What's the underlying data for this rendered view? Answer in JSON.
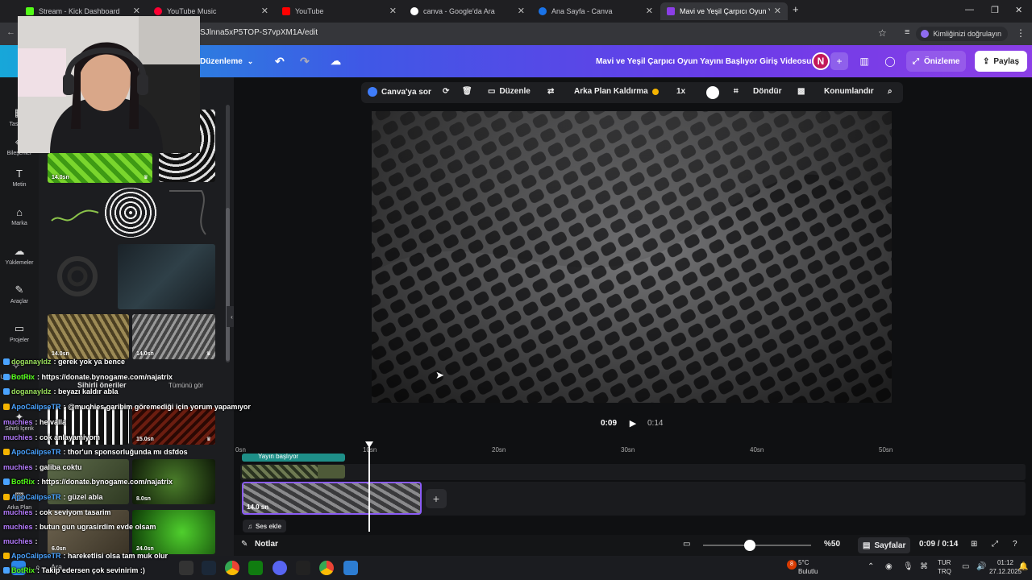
{
  "browser": {
    "tabs": [
      {
        "label": "Stream - Kick Dashboard",
        "color": "#53fc18"
      },
      {
        "label": "YouTube Music",
        "color": "#ff0033"
      },
      {
        "label": "YouTube",
        "color": "#ff0000"
      },
      {
        "label": "canva - Google'da Ara",
        "color": "#ffffff"
      },
      {
        "label": "Ana Sayfa - Canva",
        "color": "#1a73e8"
      },
      {
        "label": "Mavi ve Yeşil Çarpıcı Oyun Yayını",
        "color": "#8b3ee6"
      }
    ],
    "new_tab": "+",
    "url": "SJlnna5xP5TOP-S7vpXM1A/edit",
    "verify_label": "Kimliğinizi doğrulayın"
  },
  "canva_header": {
    "edit_menu": "Düzenleme",
    "doc_title": "Mavi ve Yeşil Çarpıcı Oyun Yayını Başlıyor Giriş Videosu",
    "avatar_letter": "N",
    "preview": "Önizleme",
    "share": "Paylaş"
  },
  "left_rail": [
    {
      "label": "Tasarım",
      "icon": "layout-icon"
    },
    {
      "label": "Bileşenler",
      "icon": "elements-icon"
    },
    {
      "label": "Metin",
      "icon": "text-icon"
    },
    {
      "label": "Marka",
      "icon": "brand-icon"
    },
    {
      "label": "Yüklemeler",
      "icon": "upload-icon"
    },
    {
      "label": "Araçlar",
      "icon": "tools-icon"
    },
    {
      "label": "Projeler",
      "icon": "folder-icon"
    },
    {
      "label": "Uygulamalar",
      "icon": "apps-icon"
    },
    {
      "label": "Sihirli İçerik",
      "icon": "magic-icon"
    },
    {
      "label": "Arka Plan",
      "icon": "background-icon"
    }
  ],
  "side_panel": {
    "thumbs": [
      {
        "dur": "14.0sn"
      },
      {
        "dur": "14.0sn"
      },
      {
        "dur": "14.0sn"
      },
      {
        "dur": "15.0sn"
      },
      {
        "dur": "8.0sn"
      },
      {
        "dur": "6.0sn"
      },
      {
        "dur": "24.0sn"
      }
    ],
    "section_title": "Sihirli öneriler",
    "section_link": "Tümünü gör"
  },
  "context_toolbar": {
    "ask_canva": "Canva'ya sor",
    "edit": "Düzenle",
    "bg_remove": "Arka Plan Kaldırma",
    "speed": "1x",
    "rotate": "Döndür",
    "position": "Konumlandır"
  },
  "playback": {
    "current": "0:09",
    "total": "0:14"
  },
  "timeline": {
    "ticks": [
      "0sn",
      "10sn",
      "20sn",
      "30sn",
      "40sn",
      "50sn"
    ],
    "text_track_label": "Yayın başlıyor",
    "clip_duration": "14.0 sn",
    "add_audio": "Ses ekle",
    "progress_fraction": 0.64
  },
  "bottom_bar": {
    "notes": "Notlar",
    "zoom": "%50",
    "zoom_fraction": 0.43,
    "pages": "Sayfalar",
    "time": "0:09 / 0:14"
  },
  "chat": [
    {
      "user": "doganayldz",
      "msg": ": gerek yok ya bence",
      "color": "#9be15d"
    },
    {
      "user": "BotRix",
      "msg": ": https://donate.bynogame.com/najatrix",
      "color": "#53fc18"
    },
    {
      "user": "doganayldz",
      "msg": ": beyazı kaldır abla",
      "color": "#9be15d"
    },
    {
      "user": "ApoCalipseTR",
      "msg": ": @muchies garibim göremediği için yorum yapamıyor",
      "color": "#4aa3ff"
    },
    {
      "user": "muchies",
      "msg": ": he valla",
      "color": "#b57bff"
    },
    {
      "user": "muchies",
      "msg": ": cok anlayamiyom",
      "color": "#b57bff"
    },
    {
      "user": "ApoCalipseTR",
      "msg": ": thor'un sponsorluğunda mı dsfdos",
      "color": "#4aa3ff"
    },
    {
      "user": "muchies",
      "msg": ": galiba coktu",
      "color": "#b57bff"
    },
    {
      "user": "BotRix",
      "msg": ": https://donate.bynogame.com/najatrix",
      "color": "#53fc18"
    },
    {
      "user": "ApoCalipseTR",
      "msg": ": güzel abla",
      "color": "#4aa3ff"
    },
    {
      "user": "muchies",
      "msg": ": cok seviyom tasarim",
      "color": "#b57bff"
    },
    {
      "user": "muchies",
      "msg": ": butun gun ugrasirdim evde olsam",
      "color": "#b57bff"
    },
    {
      "user": "muchies",
      "msg": ":",
      "color": "#b57bff"
    },
    {
      "user": "ApoCalipseTR",
      "msg": ": hareketlisi olsa tam muk olur",
      "color": "#4aa3ff"
    },
    {
      "user": "BotRix",
      "msg": ": Takip edersen çok sevinirim :)",
      "color": "#53fc18"
    }
  ],
  "taskbar": {
    "search": "Ara",
    "weather_temp": "5°C",
    "weather_desc": "Bulutlu",
    "weather_badge": "8",
    "lang_top": "TUR",
    "lang_bottom": "TRQ",
    "clock_time": "01:12",
    "clock_date": "27.12.2025"
  }
}
